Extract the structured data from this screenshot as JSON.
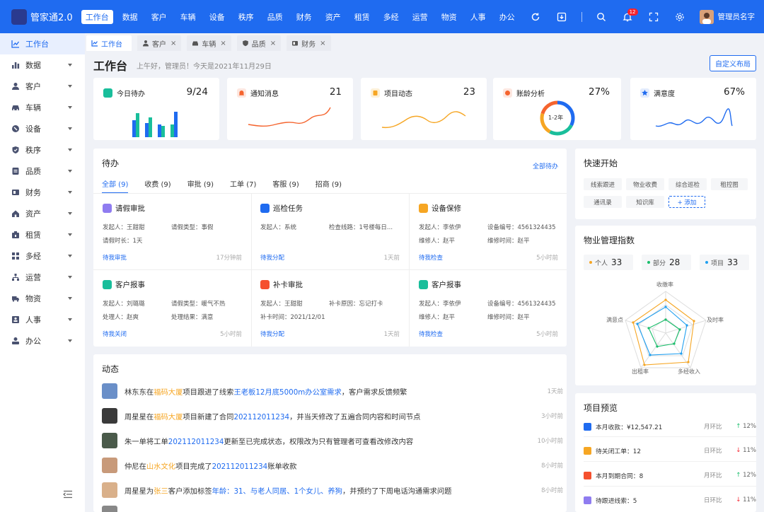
{
  "app": {
    "name": "管家通2.0",
    "user": "管理员名字",
    "notif_count": "12"
  },
  "topnav": [
    "工作台",
    "数据",
    "客户",
    "车辆",
    "设备",
    "秩序",
    "品质",
    "财务",
    "资产",
    "租赁",
    "多经",
    "运营",
    "物资",
    "人事",
    "办公"
  ],
  "sidebar": [
    "工作台",
    "数据",
    "客户",
    "车辆",
    "设备",
    "秩序",
    "品质",
    "财务",
    "资产",
    "租赁",
    "多经",
    "运营",
    "物资",
    "人事",
    "办公"
  ],
  "tabs": [
    {
      "label": "工作台",
      "close": ""
    },
    {
      "label": "客户",
      "close": "×"
    },
    {
      "label": "车辆",
      "close": "×"
    },
    {
      "label": "品质",
      "close": "×"
    },
    {
      "label": "财务",
      "close": "×"
    }
  ],
  "page": {
    "title": "工作台",
    "greeting": "上午好，管理员！今天是2021年11月29日",
    "custom_layout": "自定义布局"
  },
  "stats": [
    {
      "title": "今日待办",
      "value": "9/24",
      "color": "#19be9b"
    },
    {
      "title": "通知消息",
      "value": "21",
      "color": "#f5642e"
    },
    {
      "title": "项目动态",
      "value": "23",
      "color": "#f6a623"
    },
    {
      "title": "账龄分析",
      "value": "27%",
      "color": "#f5642e",
      "ring_label": "1-2年"
    },
    {
      "title": "满意度",
      "value": "67%",
      "color": "#1f6bf0"
    }
  ],
  "todo": {
    "title": "待办",
    "all_link": "全部待办",
    "tabs": [
      "全部 (9)",
      "收费 (9)",
      "审批 (9)",
      "工单 (7)",
      "客服 (9)",
      "招商 (9)"
    ],
    "tasks": [
      {
        "title": "请假审批",
        "color": "#8f7cf0",
        "r1a": "发起人：王甜甜",
        "r1b": "请假类型：事假",
        "r2a": "请假时长：1天",
        "r2b": "",
        "status": "待我审批",
        "time": "17分钟前"
      },
      {
        "title": "巡检任务",
        "color": "#1f6bf0",
        "r1a": "发起人：系统",
        "r1b": "检查线路：1号楼每日...",
        "r2a": "",
        "r2b": "",
        "status": "待我分配",
        "time": "1天前"
      },
      {
        "title": "设备保修",
        "color": "#f6a623",
        "r1a": "发起人：李依伊",
        "r1b": "设备编号：4561324435",
        "r2a": "维修人：赵平",
        "r2b": "维修时间：赵平",
        "status": "待我检查",
        "time": "5小时前"
      },
      {
        "title": "客户报事",
        "color": "#19be9b",
        "r1a": "发起人：刘璐璐",
        "r1b": "请假类型：暖气不热",
        "r2a": "处理人：赵爽",
        "r2b": "处理结果：满意",
        "status": "待我关闭",
        "time": "5小时前"
      },
      {
        "title": "补卡审批",
        "color": "#f5502e",
        "r1a": "发起人：王甜甜",
        "r1b": "补卡原因：忘记打卡",
        "r2a": "补卡时间：2021/12/01",
        "r2b": "",
        "status": "待我分配",
        "time": "1天前"
      },
      {
        "title": "客户报事",
        "color": "#19be9b",
        "r1a": "发起人：李依伊",
        "r1b": "设备编号：4561324435",
        "r2a": "维修人：赵平",
        "r2b": "维修时间：赵平",
        "status": "待我检查",
        "time": "5小时前"
      }
    ]
  },
  "activity": {
    "title": "动态",
    "items": [
      {
        "p1": "林东东在",
        "p2": "福码大厦",
        "p3": "项目跟进了线索",
        "p4": "王老板12月底5000m办公室需求",
        "p5": "，客户需求反馈频繁",
        "time": "1天前"
      },
      {
        "p1": "周星星在",
        "p2": "福码大厦",
        "p3": "项目新建了合同",
        "p4": "202112011234",
        "p5": "，并当天修改了五遍合同内容和时间节点",
        "time": "3小时前"
      },
      {
        "p1": "朱一单将工单",
        "p2": "",
        "p3": "",
        "p4": "202112011234",
        "p5": "更新至已完成状态，权限改为只有管理者可查看改修改内容",
        "time": "10小时前"
      },
      {
        "p1": "仲尼在",
        "p2": "山水文化",
        "p3": "项目完成了",
        "p4": "202112011234",
        "p5": "账单收款",
        "time": "8小时前"
      },
      {
        "p1": "周星星为",
        "p2": "张三",
        "p3": "客户添加标签",
        "p4": "年龄：31、与老人同居、1个女儿、养狗",
        "p5": "，并预约了下周电话沟通需求问题",
        "time": "8小时前"
      }
    ]
  },
  "quick": {
    "title": "快速开始",
    "tags": [
      "线索跟进",
      "物业收费",
      "综合巡检",
      "租控图",
      "通讯录",
      "知识库"
    ],
    "add": "+ 添加"
  },
  "index": {
    "title": "物业管理指数",
    "tabs": [
      {
        "label": "个人",
        "value": "33",
        "color": "#f6a623"
      },
      {
        "label": "部分",
        "value": "28",
        "color": "#19be6b"
      },
      {
        "label": "项目",
        "value": "33",
        "color": "#1f9ff0"
      }
    ],
    "axes": [
      "收缴率",
      "及时率",
      "多经收入",
      "出租率",
      "满意点"
    ]
  },
  "preview": {
    "title": "项目预览",
    "rows": [
      {
        "label": "本月收款：",
        "value": "¥12,547.21",
        "hb": "月环比",
        "dir": "↑",
        "pct": "12%",
        "color": "#1f6bf0"
      },
      {
        "label": "待关闭工单：",
        "value": "12",
        "hb": "日环比",
        "dir": "↓",
        "pct": "11%",
        "color": "#f6a623"
      },
      {
        "label": "本月到期合同：",
        "value": "8",
        "hb": "月环比",
        "dir": "↑",
        "pct": "12%",
        "color": "#f5502e"
      },
      {
        "label": "待跟进线索：",
        "value": "5",
        "hb": "日环比",
        "dir": "↓",
        "pct": "11%",
        "color": "#8f7cf0"
      }
    ]
  }
}
